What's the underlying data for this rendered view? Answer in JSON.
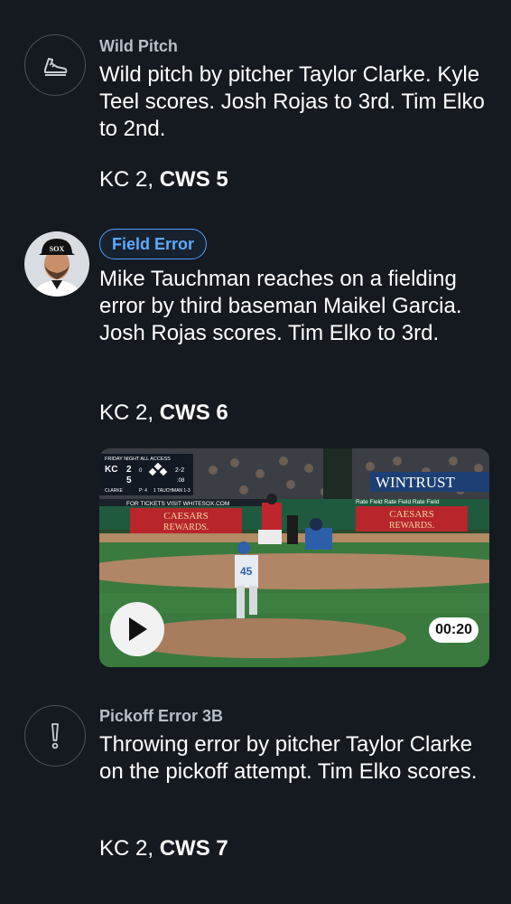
{
  "plays": [
    {
      "type_label": "Wild Pitch",
      "icon": "running-shoe-icon",
      "description": "Wild pitch by pitcher Taylor Clarke. Kyle Teel scores. Josh Rojas to 3rd. Tim Elko to 2nd.",
      "score": {
        "away": "KC 2,",
        "home": "CWS 5"
      }
    },
    {
      "type_label": "Field Error",
      "icon": "player-headshot",
      "description": "Mike Tauchman reaches on a fielding error by third baseman Maikel Garcia. Josh Rojas scores. Tim Elko to 3rd.",
      "score": {
        "away": "KC 2,",
        "home": "CWS 6"
      },
      "video": {
        "duration": "00:20",
        "overlay_header": "FRIDAY NIGHT ALL ACCESS",
        "scorebug_away": "KC",
        "scorebug_away_runs": "2",
        "scorebug_home_runs": "5",
        "scorebug_count": "2-2",
        "scorebug_outs": "0",
        "scorebug_pitch_count": ":08",
        "scorebug_pitcher": "CLARKE",
        "scorebug_pitches": "P: 4",
        "scorebug_batter": "1 TAUCHMAN 1-3",
        "ad_text": "FOR TICKETS VISIT WHITESOX.COM",
        "sign_left_1": "CAESARS",
        "sign_left_2": "REWARDS.",
        "sign_right_1": "CAESARS",
        "sign_right_2": "REWARDS.",
        "right_banner": "WINTRUST",
        "rate_field": "Rate Field  Rate Field  Rate Field",
        "pitcher_number": "45"
      }
    },
    {
      "type_label": "Pickoff Error 3B",
      "icon": "exclamation-icon",
      "description": "Throwing error by pitcher Taylor Clarke on the pickoff attempt. Tim Elko scores.",
      "score": {
        "away": "KC 2,",
        "home": "CWS 7"
      }
    }
  ],
  "colors": {
    "background": "#151a21",
    "badge_blue": "#4d9dff",
    "label_gray": "#b8bec6"
  }
}
